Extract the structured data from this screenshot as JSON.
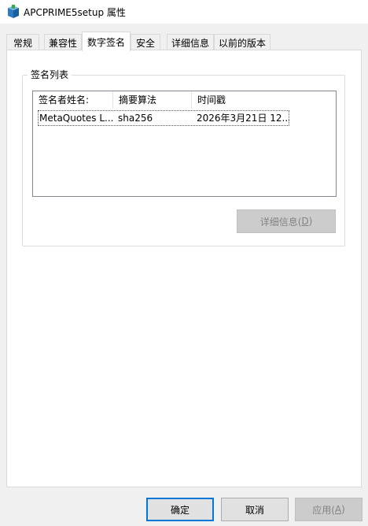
{
  "window": {
    "title": "APCPRIME5setup 属性",
    "icon": "installer-box-icon"
  },
  "tabs": [
    {
      "label": "常规"
    },
    {
      "label": "兼容性"
    },
    {
      "label": "数字签名",
      "active": true
    },
    {
      "label": "安全"
    },
    {
      "label": "详细信息"
    },
    {
      "label": "以前的版本"
    }
  ],
  "signature_group": {
    "legend": "签名列表",
    "columns": [
      "签名者姓名:",
      "摘要算法",
      "时间戳"
    ],
    "rows": [
      {
        "signer": "MetaQuotes L...",
        "digest": "sha256",
        "timestamp": "2026年3月21日 12..."
      }
    ],
    "details_button": {
      "label": "详细信息(",
      "mnemonic": "D",
      "suffix": ")",
      "enabled": false
    }
  },
  "buttons": {
    "ok": "确定",
    "cancel": "取消",
    "apply": {
      "label": "应用(",
      "mnemonic": "A",
      "suffix": ")",
      "enabled": false
    }
  },
  "colors": {
    "accent": "#0078d7",
    "disabled_text": "#838383"
  }
}
